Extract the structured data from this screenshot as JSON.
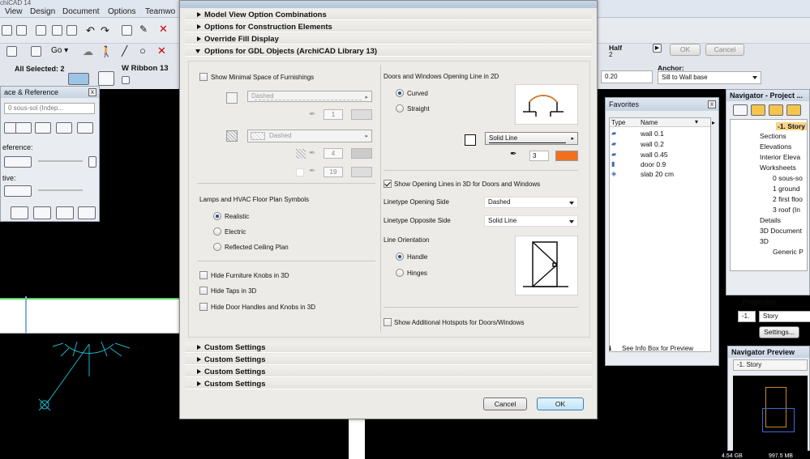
{
  "menubar": {
    "items": [
      "View",
      "Design",
      "Document",
      "Options",
      "Teamwo"
    ],
    "app_title_fragment": "ArchiCAD 14"
  },
  "toolbar": {
    "selection_label": "All Selected: 2",
    "go_label": "Go",
    "ribbon_label": "W Ribbon 13",
    "half_label": "Half",
    "half_value": "2",
    "ok_label": "OK",
    "cancel_label": "Cancel",
    "anchor_label": "Anchor:",
    "anchor_value": "Sill to Wall base",
    "offset_value": "0.20"
  },
  "trace_panel": {
    "title": "ace & Reference",
    "story_field": "0 sous-sol (Indep...",
    "reference_label": "eference:",
    "active_label": "tive:"
  },
  "favorites": {
    "title": "Favorites",
    "col_type": "Type",
    "col_name": "Name",
    "items": [
      "wall 0.1",
      "wall 0.2",
      "wall 0.45",
      "door 0.9",
      "slab 20 cm"
    ],
    "info_link": "See Info Box for Preview"
  },
  "navigator": {
    "title": "Navigator - Project ...",
    "selected": "-1. Story",
    "items": [
      "Sections",
      "Elevations",
      "Interior Eleva",
      "Worksheets",
      "0 sous-so",
      "1 ground",
      "2 first floo",
      "3 roof (In",
      "Details",
      "3D Document",
      "3D",
      "Generic P"
    ],
    "properties_label": "Properties",
    "prop_num": "-1.",
    "prop_name": "Story",
    "settings_button": "Settings..."
  },
  "nav_preview": {
    "title": "Navigator Preview",
    "dropdown": "-1. Story"
  },
  "status": {
    "left": "4.54 GB",
    "right": "997.5 MB"
  },
  "dialog": {
    "sections_top": [
      "Model View Option Combinations",
      "Options for Construction Elements",
      "Override Fill Display"
    ],
    "open_section": "Options for GDL Objects (ArchiCAD Library 13)",
    "left": {
      "show_min_space": "Show Minimal Space of Furnishings",
      "line_type_1": "Dashed",
      "pen_1": "1",
      "fill_type": "Dashed",
      "pen_2": "4",
      "pen_3": "19",
      "lamps_title": "Lamps and HVAC Floor Plan Symbols",
      "lamp_options": [
        "Realistic",
        "Electric",
        "Reflected Ceiling Plan"
      ],
      "hide_knobs": "Hide Furniture Knobs in 3D",
      "hide_taps": "Hide Taps in 3D",
      "hide_handles": "Hide Door Handles and Knobs in 3D"
    },
    "right": {
      "opening_line_title": "Doors and Windows Opening Line in 2D",
      "opening_options": [
        "Curved",
        "Straight"
      ],
      "line_type": "Solid Line",
      "pen_value": "3",
      "show_3d": "Show Opening Lines in 3D for Doors and Windows",
      "linetype_opening_label": "Linetype Opening Side",
      "linetype_opening_value": "Dashed",
      "linetype_opposite_label": "Linetype Opposite Side",
      "linetype_opposite_value": "Solid Line",
      "orientation_title": "Line Orientation",
      "orientation_options": [
        "Handle",
        "Hinges"
      ],
      "hotspots": "Show Additional Hotspots for Doors/Windows"
    },
    "sections_bottom": [
      "Custom Settings",
      "Custom Settings",
      "Custom Settings",
      "Custom Settings"
    ],
    "cancel": "Cancel",
    "ok": "OK"
  },
  "colors": {
    "accent": "#2a4f8a",
    "orange": "#f07020",
    "background": "#000000"
  }
}
